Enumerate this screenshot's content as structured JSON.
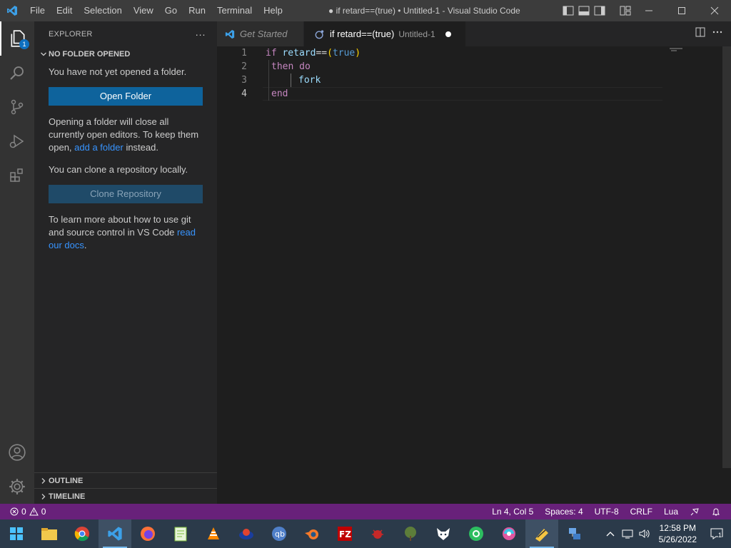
{
  "window": {
    "title": "● if retard==(true) • Untitled-1 - Visual Studio Code"
  },
  "menu": [
    "File",
    "Edit",
    "Selection",
    "View",
    "Go",
    "Run",
    "Terminal",
    "Help"
  ],
  "activity": {
    "explorer_badge": "1"
  },
  "sidebar": {
    "header": "EXPLORER",
    "more": "···",
    "section": "NO FOLDER OPENED",
    "msg1": "You have not yet opened a folder.",
    "open_folder": "Open Folder",
    "msg2_a": "Opening a folder will close all currently open editors. To keep them open, ",
    "msg2_link": "add a folder",
    "msg2_b": " instead.",
    "msg3": "You can clone a repository locally.",
    "clone": "Clone Repository",
    "msg4_a": "To learn more about how to use git and source control in VS Code ",
    "msg4_link": "read our docs",
    "msg4_b": ".",
    "outline": "OUTLINE",
    "timeline": "TIMELINE"
  },
  "tabs": [
    {
      "label": "Get Started"
    },
    {
      "label": "if retard==(true)",
      "desc": "Untitled-1"
    }
  ],
  "editor": {
    "lines": [
      {
        "num": "1"
      },
      {
        "num": "2"
      },
      {
        "num": "3"
      },
      {
        "num": "4"
      }
    ],
    "tokens": {
      "l1_if": "if",
      "l1_id": "retard",
      "l1_op": "==",
      "l1_po": "(",
      "l1_true": "true",
      "l1_pc": ")",
      "l2_then": "then",
      "l2_do": "do",
      "l3_fork": "fork",
      "l4_end": "end"
    }
  },
  "status": {
    "errors": "0",
    "warnings": "0",
    "position": "Ln 4, Col 5",
    "spaces": "Spaces: 4",
    "encoding": "UTF-8",
    "eol": "CRLF",
    "language": "Lua"
  },
  "taskbar": {
    "time": "12:58 PM",
    "date": "5/26/2022",
    "notifications": "1"
  },
  "colors": {
    "statusbar": "#68217a",
    "accent": "#0e639c",
    "link": "#3794ff"
  }
}
